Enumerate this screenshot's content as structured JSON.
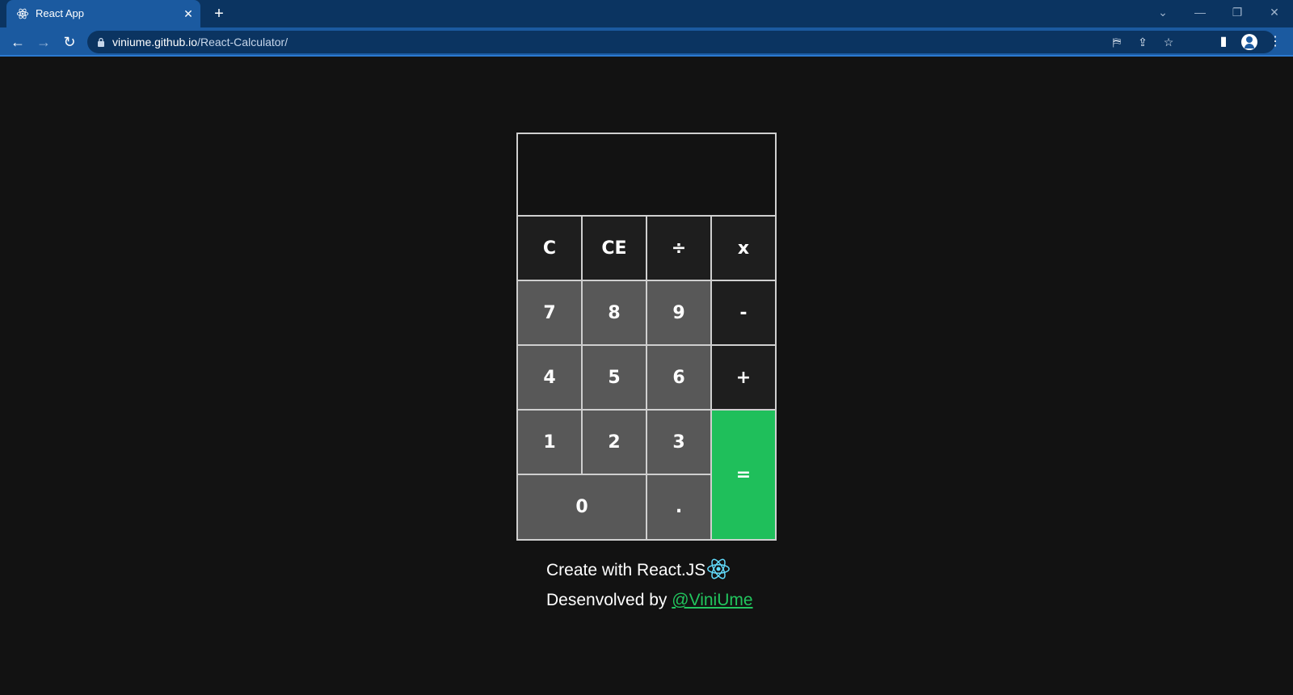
{
  "browser": {
    "tab_title": "React App",
    "tab_close": "✕",
    "new_tab": "+",
    "url_domain": "viniume.github.io",
    "url_path": "/React-Calculator/",
    "window_controls": {
      "dropdown": "⌄",
      "minimize": "—",
      "restore": "❐",
      "close": "✕"
    },
    "nav": {
      "back": "←",
      "forward": "→",
      "reload": "↻"
    },
    "omnibox_icons": {
      "translate": "⛿",
      "share": "⇪",
      "bookmark": "☆"
    },
    "toolbar_icons": {
      "side_panel": "▮",
      "menu": "⋮"
    }
  },
  "calculator": {
    "display_value": "",
    "keys": [
      {
        "label": "C",
        "kind": "op"
      },
      {
        "label": "CE",
        "kind": "op"
      },
      {
        "label": "÷",
        "kind": "op"
      },
      {
        "label": "x",
        "kind": "op"
      },
      {
        "label": "7",
        "kind": "num"
      },
      {
        "label": "8",
        "kind": "num"
      },
      {
        "label": "9",
        "kind": "num"
      },
      {
        "label": "-",
        "kind": "op"
      },
      {
        "label": "4",
        "kind": "num"
      },
      {
        "label": "5",
        "kind": "num"
      },
      {
        "label": "6",
        "kind": "num"
      },
      {
        "label": "+",
        "kind": "op"
      },
      {
        "label": "1",
        "kind": "num"
      },
      {
        "label": "2",
        "kind": "num"
      },
      {
        "label": "3",
        "kind": "num"
      },
      {
        "label": "=",
        "kind": "eq"
      },
      {
        "label": "0",
        "kind": "num"
      },
      {
        "label": ".",
        "kind": "num"
      }
    ]
  },
  "footer": {
    "line1": "Create with React.JS",
    "line2_prefix": "Desenvolved by ",
    "author_link": "@ViniUme"
  },
  "colors": {
    "page_bg": "#121212",
    "operator_key": "#1e1e1e",
    "number_key": "#585858",
    "equals_key": "#1fbf5b",
    "link": "#22c55e",
    "react_logo": "#61dafb"
  },
  "icons": {
    "tab_favicon": "react-logo-icon",
    "footer_logo": "react-logo-icon",
    "lock": "lock-icon"
  }
}
